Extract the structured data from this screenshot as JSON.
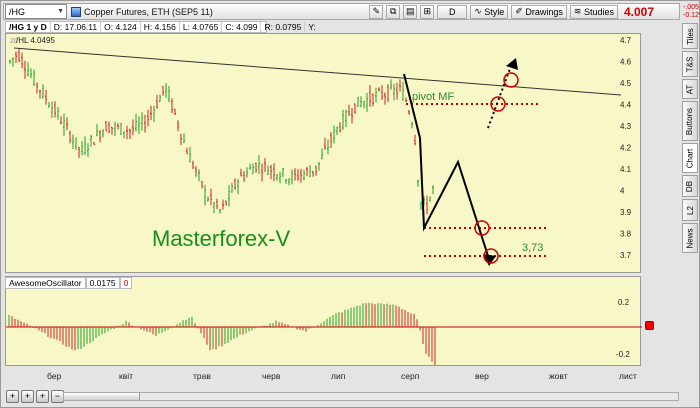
{
  "toolbar": {
    "symbol": "/HG",
    "description": "Copper Futures, ETH (SEP5 11)",
    "buttons": {
      "d_label": "D",
      "style_label": "Style",
      "drawings_label": "Drawings",
      "studies_label": "Studies"
    },
    "last_price": "4.007",
    "change": "-.005",
    "change_pct": "-0.12%"
  },
  "ohlc": {
    "timeframe": "/HG 1 y D",
    "date": "D: 17.06.11",
    "open": "O: 4.124",
    "high": "H: 4.156",
    "low": "L: 4.0765",
    "close": "C: 4.099",
    "range": "R: 0.0795",
    "y": "Y:"
  },
  "main_chart": {
    "watermark_copyright": "20",
    "small_label": "/HL 4.0495",
    "brand_text": "Masterforex-V",
    "pivot_label": "pivot MF",
    "target_label": "3,73",
    "y_ticks": [
      "4.7",
      "4.6",
      "4.5",
      "4.4",
      "4.3",
      "4.2",
      "4.1",
      "4",
      "3.9",
      "3.8",
      "3.7"
    ],
    "colors": {
      "up": "#22a022",
      "down": "#d02020",
      "background": "#f7f7c8",
      "brand": "#1a8f1a",
      "dotted": "#c00000",
      "circle": "#d00000"
    }
  },
  "oscillator": {
    "name": "AwesomeOscillator",
    "value": "0.0175",
    "zero": "0",
    "y_ticks": [
      "0.2",
      "-0.2"
    ]
  },
  "x_axis": {
    "ticks": [
      "бер",
      "квіт",
      "трав",
      "черв",
      "лип",
      "серп",
      "вер",
      "жовт",
      "лист"
    ]
  },
  "sidebar": {
    "tabs": [
      "Tiles",
      "T&S",
      "AT",
      "Buttons",
      "Chart",
      "DB",
      "L2",
      "News"
    ]
  },
  "bottombar": {
    "buttons": [
      "+",
      "+",
      "+",
      "−"
    ]
  },
  "chart_data": {
    "type": "line",
    "x": [
      "бер",
      "квіт",
      "трав",
      "черв",
      "лип",
      "серп",
      "вер",
      "жовт",
      "лист"
    ],
    "ylim": [
      3.65,
      4.7
    ],
    "y_ticks": [
      4.7,
      4.6,
      4.5,
      4.4,
      4.3,
      4.2,
      4.1,
      4.0,
      3.9,
      3.8,
      3.7
    ],
    "annotations": [
      "pivot MF",
      "3,73"
    ],
    "series": []
  }
}
